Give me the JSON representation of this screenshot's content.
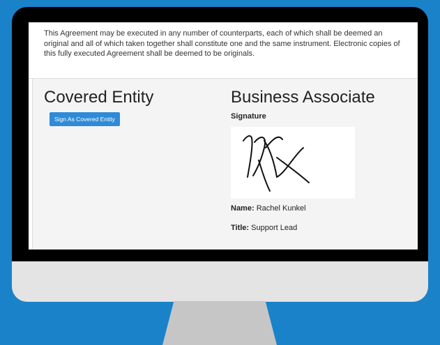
{
  "agreement_text": "This Agreement may be executed in any number of counterparts, each of which shall be deemed an original and all of which taken together shall constitute one and the same instrument. Electronic copies of this fully executed Agreement shall be deemed to be originals.",
  "covered_entity": {
    "heading": "Covered Entity",
    "sign_button_label": "Sign As Covered Entity"
  },
  "business_associate": {
    "heading": "Business Associate",
    "signature_label": "Signature",
    "name_label": "Name:",
    "name_value": "Rachel Kunkel",
    "title_label": "Title:",
    "title_value": "Support Lead"
  },
  "colors": {
    "background": "#1a82c9",
    "button": "#2f8ad8",
    "panel": "#f4f4f4"
  }
}
